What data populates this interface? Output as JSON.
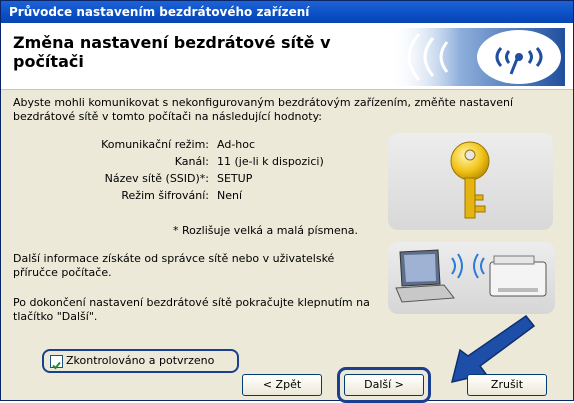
{
  "window": {
    "title": "Průvodce nastavením bezdrátového zařízení"
  },
  "header": {
    "title": "Změna nastavení bezdrátové sítě v počítači"
  },
  "intro": "Abyste mohli komunikovat s nekonfigurovaným bezdrátovým zařízením, změňte nastavení bezdrátové sítě v tomto počítači na následující hodnoty:",
  "settings": [
    {
      "label": "Komunikační režim:",
      "value": "Ad-hoc"
    },
    {
      "label": "Kanál:",
      "value": "11   (je-li k dispozici)"
    },
    {
      "label": "Název sítě (SSID)*:",
      "value": "SETUP"
    },
    {
      "label": "Režim šifrování:",
      "value": "Není"
    }
  ],
  "note": "* Rozlišuje velká a malá písmena.",
  "info": "Další informace získáte od správce sítě nebo v uživatelské příručce počítače.",
  "finish": "Po dokončení nastavení bezdrátové sítě pokračujte klepnutím na tlačítko \"Další\".",
  "checkbox": {
    "label": "Zkontrolováno a potvrzeno",
    "checked": true
  },
  "buttons": {
    "back": "< Zpět",
    "next": "Další >",
    "cancel": "Zrušit"
  },
  "icons": {
    "header_emblem": "wireless-signal-icon",
    "key": "key-icon",
    "laptop_printer": "laptop-printer-wireless-icon",
    "arrow": "pointer-arrow-icon"
  },
  "colors": {
    "titlebar": "#0a4fc4",
    "dialog_bg": "#ece9d8",
    "highlight": "#1b3f8f",
    "header_accent": "#1f4f9e"
  }
}
